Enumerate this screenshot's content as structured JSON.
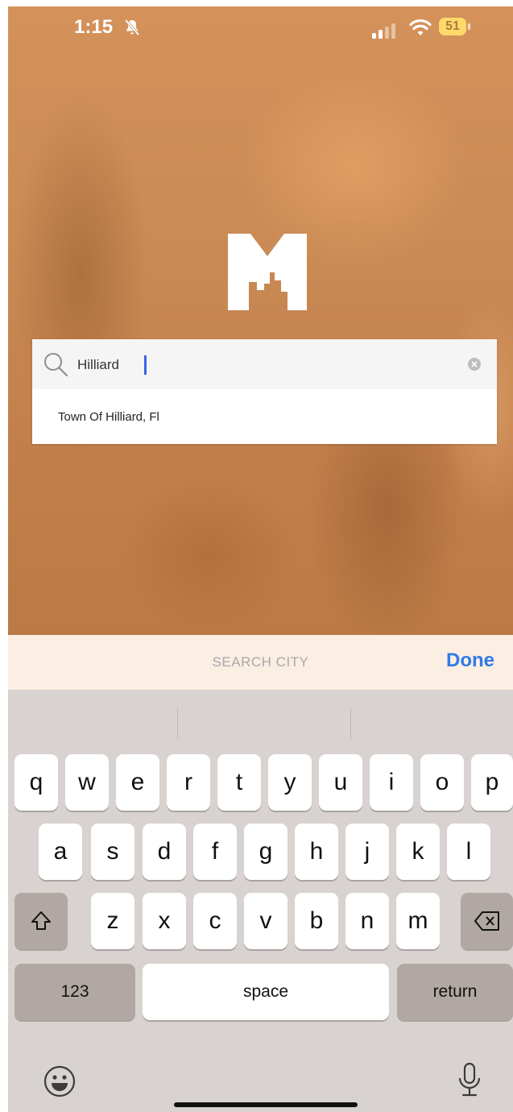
{
  "status_bar": {
    "time": "1:15",
    "battery": "51"
  },
  "search": {
    "query": "Hilliard",
    "results": [
      "Town Of Hilliard, Fl"
    ]
  },
  "toolbar": {
    "title": "SEARCH CITY",
    "done_label": "Done"
  },
  "keyboard": {
    "row1": [
      "q",
      "w",
      "e",
      "r",
      "t",
      "y",
      "u",
      "i",
      "o",
      "p"
    ],
    "row2": [
      "a",
      "s",
      "d",
      "f",
      "g",
      "h",
      "j",
      "k",
      "l"
    ],
    "row3": [
      "z",
      "x",
      "c",
      "v",
      "b",
      "n",
      "m"
    ],
    "numbers_label": "123",
    "space_label": "space",
    "return_label": "return"
  },
  "colors": {
    "background": "#c98a54",
    "done_blue": "#2f7bea",
    "toolbar_bg": "#fbeee2",
    "keyboard_bg": "#d8d3d0"
  },
  "icons": [
    "bell-slash-icon",
    "cellular-signal-icon",
    "wifi-icon",
    "battery-icon",
    "search-icon",
    "clear-icon",
    "shift-icon",
    "delete-icon",
    "emoji-icon",
    "microphone-icon"
  ]
}
